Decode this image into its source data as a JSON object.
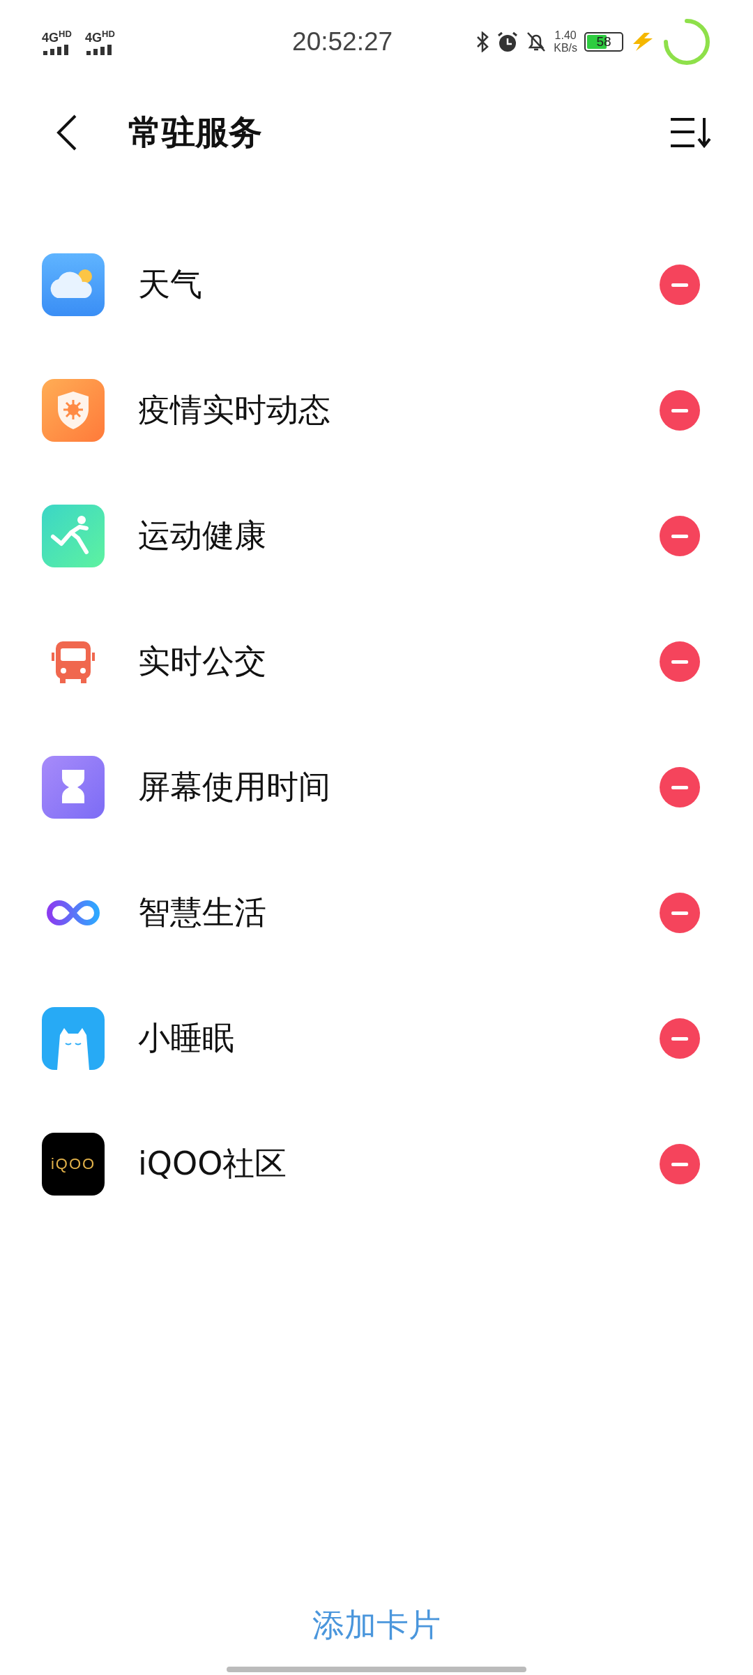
{
  "status_bar": {
    "networks": [
      "4G$^{HD}$",
      "4G$^{HD}$"
    ],
    "time": "20:52:27",
    "speed": "1.40",
    "speed_unit": "KB/s",
    "battery": {
      "label": "58",
      "level": 0.58
    },
    "charging": true
  },
  "header": {
    "title": "常驻服务"
  },
  "services": [
    {
      "name": "天气",
      "kind": "weather"
    },
    {
      "name": "疫情实时动态",
      "kind": "epidemic"
    },
    {
      "name": "运动健康",
      "kind": "sport"
    },
    {
      "name": "实时公交",
      "kind": "bus"
    },
    {
      "name": "屏幕使用时间",
      "kind": "screen-time"
    },
    {
      "name": "智慧生活",
      "kind": "infinity"
    },
    {
      "name": "小睡眠",
      "kind": "sleep"
    },
    {
      "name": "iQOO社区",
      "kind": "logo",
      "logo_text": "iQOO"
    }
  ],
  "add_button": "添加卡片"
}
